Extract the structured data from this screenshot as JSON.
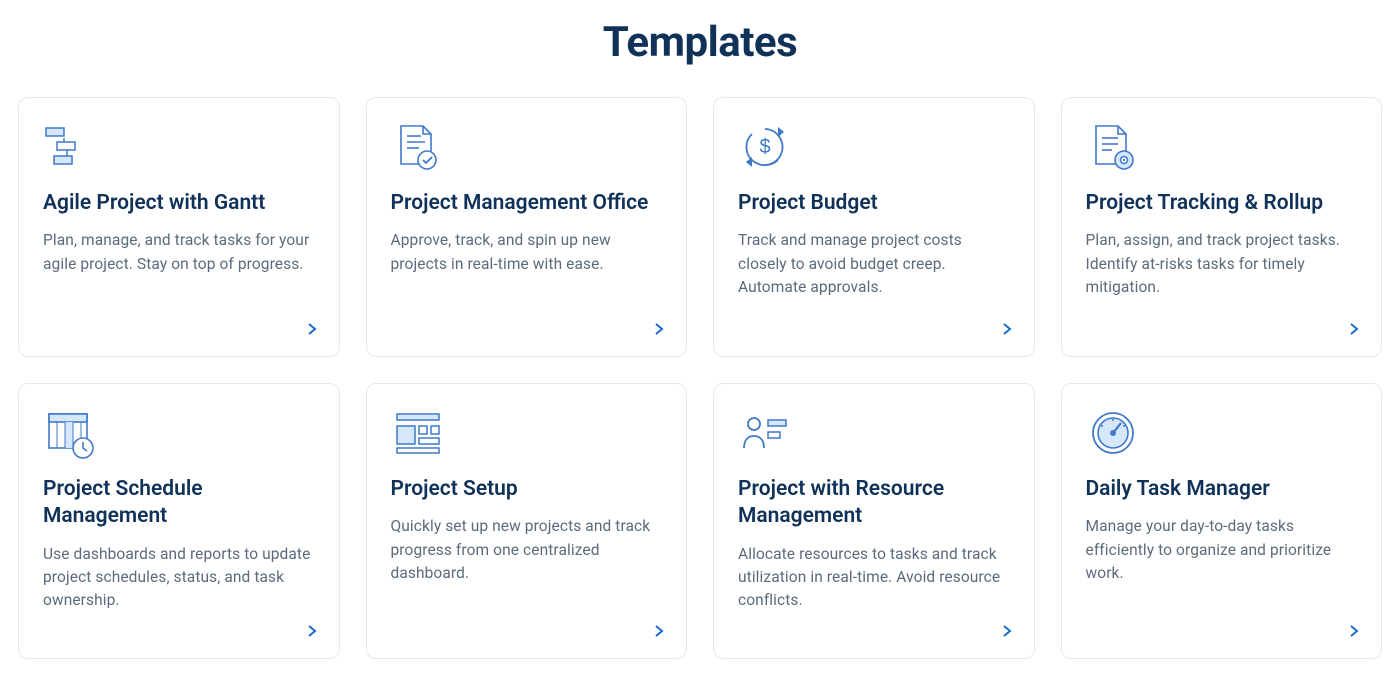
{
  "page": {
    "title": "Templates"
  },
  "templates": [
    {
      "icon": "gantt-icon",
      "title": "Agile Project with Gantt",
      "desc": "Plan, manage, and track tasks for your agile project. Stay on top of progress."
    },
    {
      "icon": "approval-icon",
      "title": "Project Management Office",
      "desc": "Approve, track, and spin up new projects in real-time with ease."
    },
    {
      "icon": "budget-icon",
      "title": "Project Budget",
      "desc": "Track and manage project costs closely to avoid budget creep. Automate approvals."
    },
    {
      "icon": "tracking-icon",
      "title": "Project Tracking & Rollup",
      "desc": "Plan, assign, and track project tasks. Identify at-risks tasks for timely mitigation."
    },
    {
      "icon": "schedule-icon",
      "title": "Project Schedule Management",
      "desc": "Use dashboards and reports to update project schedules, status, and task ownership."
    },
    {
      "icon": "setup-icon",
      "title": "Project Setup",
      "desc": "Quickly set up new projects and track progress from one centralized dashboard."
    },
    {
      "icon": "resource-icon",
      "title": "Project with Resource Management",
      "desc": "Allocate resources to tasks and track utilization in real-time. Avoid resource conflicts."
    },
    {
      "icon": "gauge-icon",
      "title": "Daily Task Manager",
      "desc": "Manage your day-to-day tasks efficiently to organize and prioritize work."
    }
  ]
}
